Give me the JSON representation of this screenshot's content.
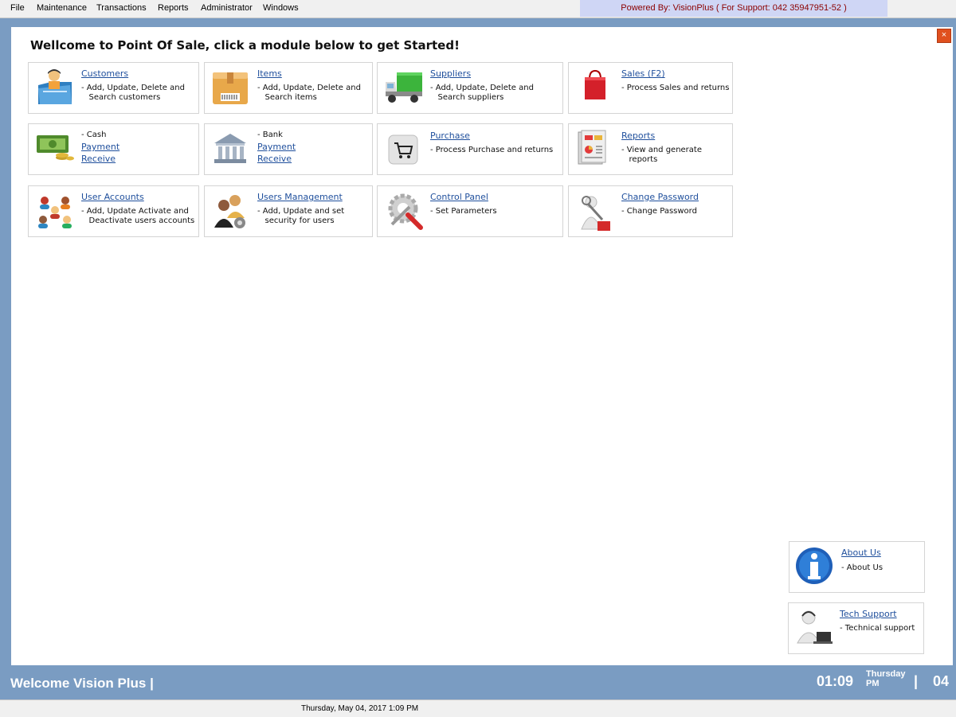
{
  "menu": [
    "File",
    "Maintenance",
    "Transactions",
    "Reports",
    "Administrator",
    "Windows"
  ],
  "powered_by": "Powered By: VisionPlus ( For Support: 042 35947951-52 )",
  "close_label": "×",
  "welcome": "Wellcome to Point Of Sale, click a module below to get Started!",
  "modules": {
    "customers": {
      "title": "Customers",
      "desc": "- Add, Update, Delete and\n   Search customers"
    },
    "items": {
      "title": "Items",
      "desc": "- Add, Update, Delete and\n   Search items"
    },
    "suppliers": {
      "title": "Suppliers",
      "desc": "- Add, Update, Delete and\n   Search suppliers"
    },
    "sales": {
      "title": "Sales (F2)",
      "desc": "- Process Sales and returns"
    },
    "cash": {
      "label": "- Cash",
      "link1": "Payment",
      "link2": "Receive"
    },
    "bank": {
      "label": "- Bank",
      "link1": "Payment",
      "link2": "Receive"
    },
    "purchase": {
      "title": "Purchase",
      "desc": "- Process Purchase and returns"
    },
    "reports": {
      "title": "Reports",
      "desc": "- View and generate\n   reports"
    },
    "user_accounts": {
      "title": "User Accounts",
      "desc": "- Add, Update Activate and\n   Deactivate users accounts"
    },
    "users_management": {
      "title": "Users Management",
      "desc": "- Add, Update and set\n   security for users"
    },
    "control_panel": {
      "title": "Control Panel",
      "desc": "- Set Parameters"
    },
    "change_password": {
      "title": "Change Password",
      "desc": "- Change Password"
    },
    "about": {
      "title": "About Us",
      "desc": "- About Us"
    },
    "tech_support": {
      "title": "Tech Support",
      "desc": "- Technical support"
    }
  },
  "footer": {
    "welcome": "Welcome Vision Plus |",
    "time": "01:09",
    "day": "Thursday",
    "ampm": "PM",
    "separator": "|",
    "day_number": "04"
  },
  "status": "Thursday, May 04, 2017 1:09 PM"
}
